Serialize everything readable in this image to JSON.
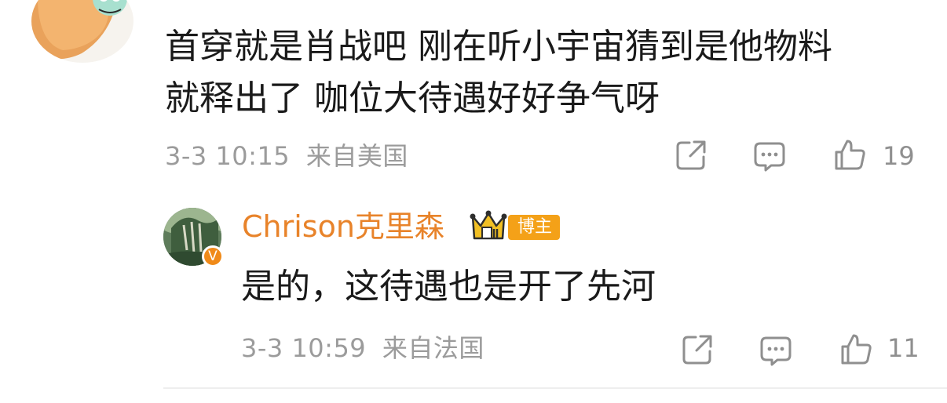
{
  "comment": {
    "text_line1": "首穿就是肖战吧 刚在听小宇宙猜到是他物料",
    "text_line2": "就释出了 咖位大待遇好好争气呀",
    "timestamp": "3-3 10:15",
    "location": "来自美国",
    "likes": "19",
    "icons": [
      "share-icon",
      "reply-icon",
      "like-icon"
    ]
  },
  "reply": {
    "author": "Chrison克里森",
    "author_tag": "博主",
    "verified_badge": "V",
    "text": "是的，这待遇也是开了先河",
    "timestamp": "3-3 10:59",
    "location": "来自法国",
    "likes": "11",
    "icons": [
      "share-icon",
      "reply-icon",
      "like-icon",
      "crown-icon"
    ]
  },
  "colors": {
    "author_name": "#e8832a",
    "tag_background": "#f4a118",
    "verified_badge": "#f08a19",
    "meta_text": "#9b9b9b",
    "icon_stroke": "#8f8f8f"
  }
}
